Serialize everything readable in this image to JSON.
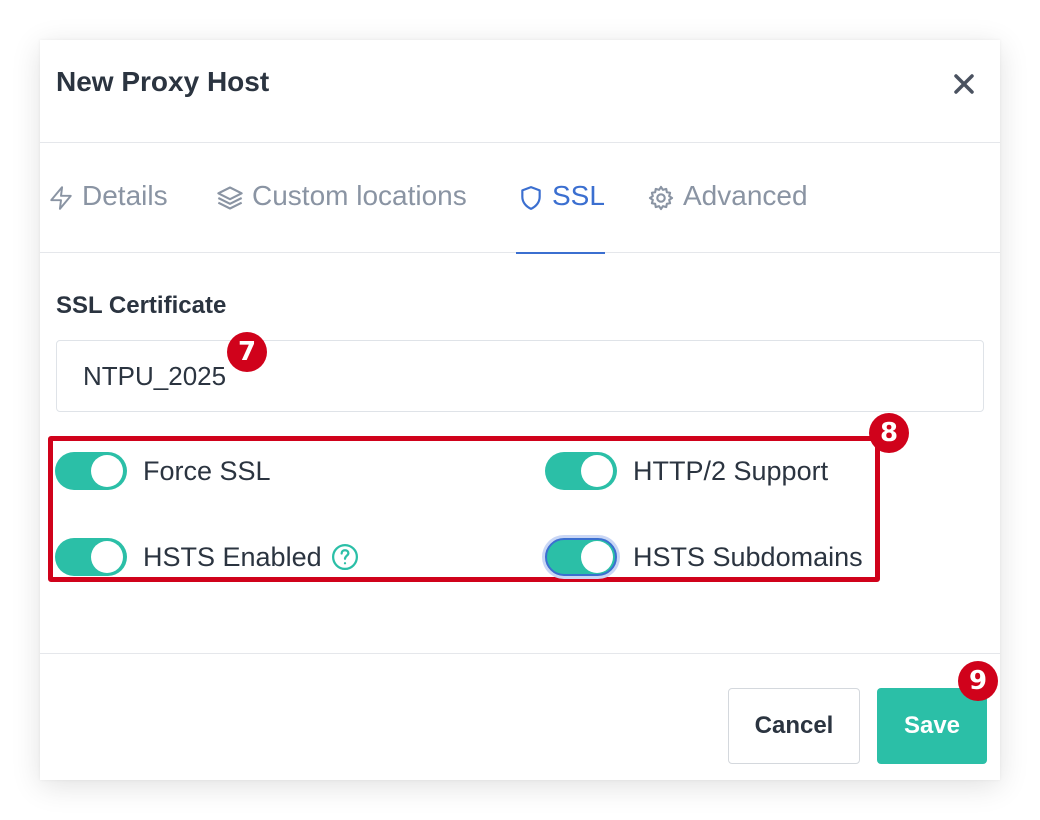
{
  "modal": {
    "title": "New Proxy Host"
  },
  "tabs": [
    {
      "label": "Details",
      "icon": "lightning-icon"
    },
    {
      "label": "Custom locations",
      "icon": "layers-icon"
    },
    {
      "label": "SSL",
      "icon": "shield-icon",
      "active": true
    },
    {
      "label": "Advanced",
      "icon": "gear-icon"
    }
  ],
  "ssl": {
    "certificate_label": "SSL Certificate",
    "certificate_value": "NTPU_2025",
    "switches": [
      {
        "label": "Force SSL",
        "on": true
      },
      {
        "label": "HTTP/2 Support",
        "on": true
      },
      {
        "label": "HSTS Enabled",
        "on": true
      },
      {
        "label": "HSTS Subdomains",
        "on": true
      }
    ]
  },
  "footer": {
    "cancel_label": "Cancel",
    "save_label": "Save"
  },
  "annotations": {
    "callout_7": "7",
    "callout_8": "8",
    "callout_9": "9"
  },
  "colors": {
    "accent_teal": "#2bbfa7",
    "active_tab_blue": "#3b6fd0",
    "annotation_red": "#d0021b"
  }
}
